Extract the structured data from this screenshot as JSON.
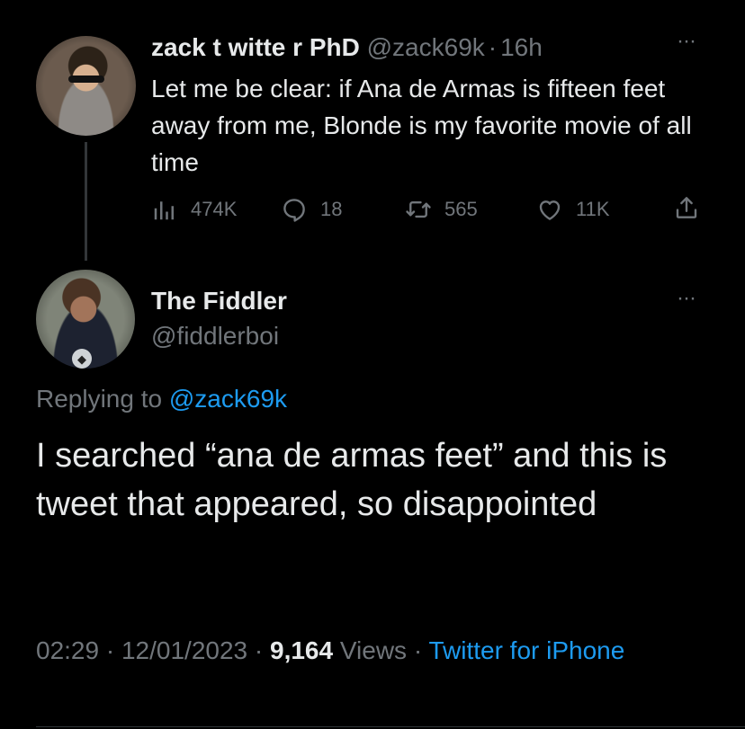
{
  "parent_tweet": {
    "display_name": "zack t witte r PhD",
    "handle": "@zack69k",
    "separator": "·",
    "time_ago": "16h",
    "more_label": "···",
    "text": "Let me be clear: if Ana de Armas is fifteen feet away from me, Blonde is my favorite movie of all time",
    "stats": {
      "views": "474K",
      "replies": "18",
      "retweets": "565",
      "likes": "11K"
    },
    "icons": {
      "views": "bar-chart-icon",
      "replies": "reply-bubble-icon",
      "retweets": "retweet-icon",
      "likes": "heart-icon",
      "share": "share-upload-icon"
    }
  },
  "reply_tweet": {
    "display_name": "The Fiddler",
    "handle": "@fiddlerboi",
    "more_label": "···",
    "replying_prefix": "Replying to",
    "replying_handle": "@zack69k",
    "text": "I searched “ana de armas feet” and this is tweet that appeared, so disappointed",
    "meta": {
      "time": "02:29",
      "dot": " · ",
      "date": "12/01/2023",
      "views_count": "9,164",
      "views_label": "Views",
      "source": "Twitter for iPhone"
    }
  },
  "colors": {
    "background": "#000000",
    "text": "#e7e9ea",
    "muted": "#71767b",
    "link": "#1d9bf0"
  }
}
